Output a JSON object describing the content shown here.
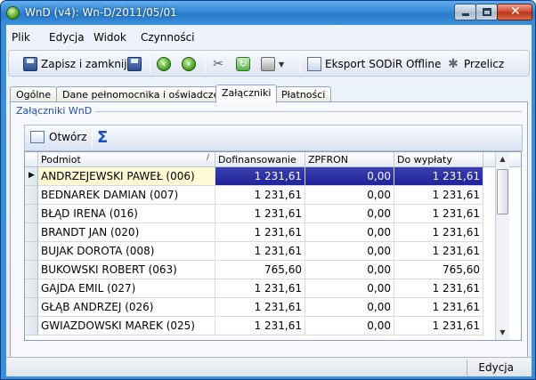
{
  "window": {
    "title": "WnD (v4): Wn-D/2011/05/01",
    "close_glyph": "✕"
  },
  "menu": [
    {
      "label": "Plik"
    },
    {
      "label": "Edycja"
    },
    {
      "label": "Widok"
    },
    {
      "label": "Czynności"
    }
  ],
  "toolbar": {
    "save_close_label": "Zapisz i zamknij",
    "export_label": "Eksport SODiR Offline",
    "recalc_label": "Przelicz",
    "icons": [
      "save-disk-icon",
      "save-icon",
      "back-arrow-icon",
      "forward-arrow-icon",
      "tools-icon",
      "refresh-icon",
      "printer-icon",
      "export-icon",
      "magic-wand-icon"
    ]
  },
  "tabs": [
    {
      "label": "Ogólne",
      "active": false
    },
    {
      "label": "Dane pełnomocnika i oświadczenia",
      "active": false
    },
    {
      "label": "Załączniki",
      "active": true
    },
    {
      "label": "Płatności",
      "active": false
    }
  ],
  "group": {
    "title": "Załączniki WnD"
  },
  "grid_toolbar": {
    "open_label": "Otwórz",
    "sigma": "Σ"
  },
  "grid": {
    "columns": [
      "Podmiot",
      "Dofinansowanie",
      "ZPFRON",
      "Do wypłaty"
    ],
    "sort_indicator": "/",
    "rows": [
      {
        "podmiot": "ANDRZEJEWSKI PAWEŁ (006)",
        "dofinansowanie": "1 231,61",
        "zpfron": "0,00",
        "do_wyplaty": "1 231,61",
        "selected": true
      },
      {
        "podmiot": "BEDNAREK DAMIAN (007)",
        "dofinansowanie": "1 231,61",
        "zpfron": "0,00",
        "do_wyplaty": "1 231,61",
        "selected": false
      },
      {
        "podmiot": "BŁĄD IRENA (016)",
        "dofinansowanie": "1 231,61",
        "zpfron": "0,00",
        "do_wyplaty": "1 231,61",
        "selected": false
      },
      {
        "podmiot": "BRANDT JAN (020)",
        "dofinansowanie": "1 231,61",
        "zpfron": "0,00",
        "do_wyplaty": "1 231,61",
        "selected": false
      },
      {
        "podmiot": "BUJAK DOROTA (008)",
        "dofinansowanie": "1 231,61",
        "zpfron": "0,00",
        "do_wyplaty": "1 231,61",
        "selected": false
      },
      {
        "podmiot": "BUKOWSKI ROBERT (063)",
        "dofinansowanie": "765,60",
        "zpfron": "0,00",
        "do_wyplaty": "765,60",
        "selected": false
      },
      {
        "podmiot": "GAJDA EMIL (027)",
        "dofinansowanie": "1 231,61",
        "zpfron": "0,00",
        "do_wyplaty": "1 231,61",
        "selected": false
      },
      {
        "podmiot": "GŁĄB ANDRZEJ (026)",
        "dofinansowanie": "1 231,61",
        "zpfron": "0,00",
        "do_wyplaty": "1 231,61",
        "selected": false
      },
      {
        "podmiot": "GWIAZDOWSKI MAREK (025)",
        "dofinansowanie": "1 231,61",
        "zpfron": "0,00",
        "do_wyplaty": "1 231,61",
        "selected": false
      }
    ]
  },
  "status": {
    "mode": "Edycja"
  }
}
